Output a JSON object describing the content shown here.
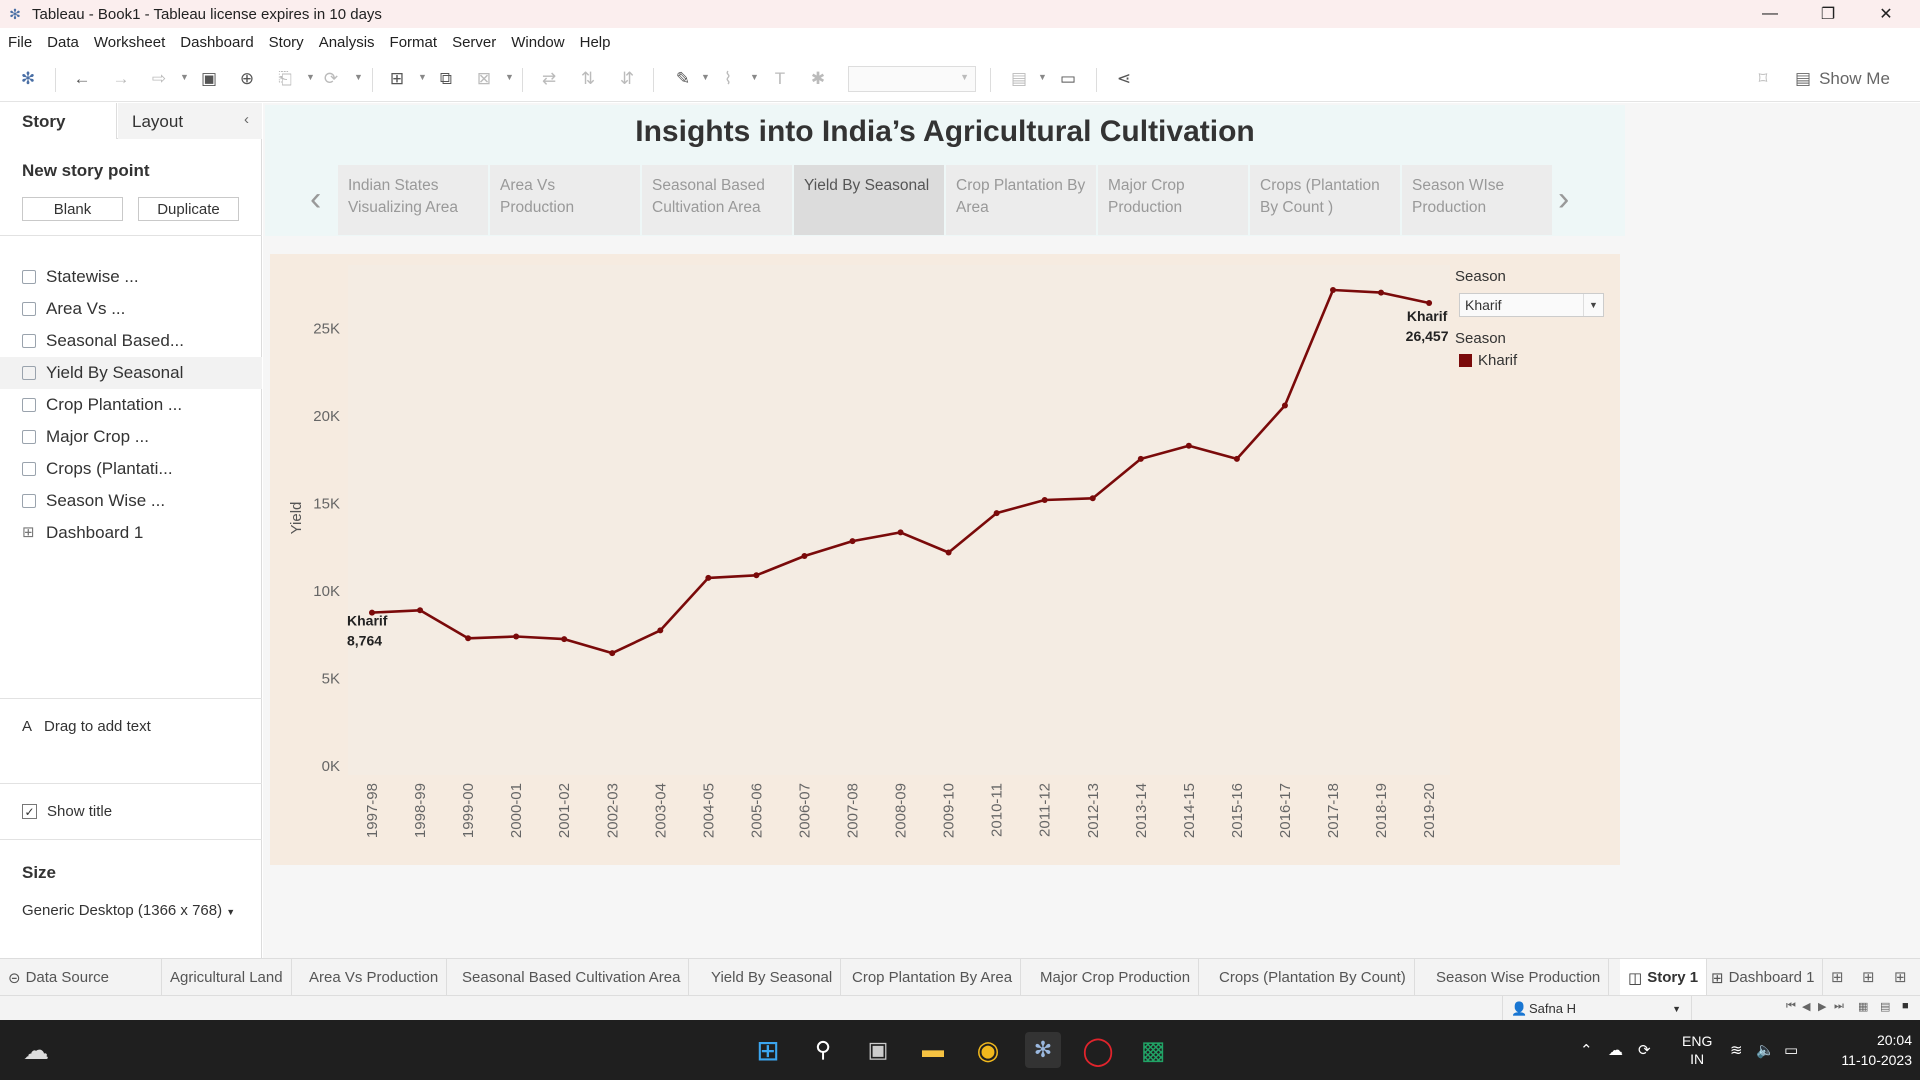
{
  "window": {
    "title": "Tableau - Book1 - Tableau license expires in 10 days",
    "minimize": "—",
    "restore": "❐",
    "close": "✕"
  },
  "menu": [
    "File",
    "Data",
    "Worksheet",
    "Dashboard",
    "Story",
    "Analysis",
    "Format",
    "Server",
    "Window",
    "Help"
  ],
  "toolbar": {
    "show_me": "Show Me"
  },
  "left_pane": {
    "tab_story": "Story",
    "tab_layout": "Layout",
    "new_story_point": "New story point",
    "blank": "Blank",
    "duplicate": "Duplicate",
    "story_points": [
      "Statewise ...",
      "Area Vs ...",
      "Seasonal Based...",
      "Yield By Seasonal",
      "Crop Plantation ...",
      "Major Crop ...",
      "Crops (Plantati...",
      "Season Wise ...",
      "Dashboard 1"
    ],
    "drag_text": "Drag to add text",
    "show_title": "Show title",
    "size_label": "Size",
    "size_value": "Generic Desktop (1366 x 768)"
  },
  "story": {
    "title": "Insights into India’s Agricultural Cultivation",
    "points": [
      {
        "label": "Indian States Visualizing Area"
      },
      {
        "label": "Area Vs Production"
      },
      {
        "label": "Seasonal Based Cultivation Area"
      },
      {
        "label": "Yield By Seasonal"
      },
      {
        "label": "Crop Plantation By Area"
      },
      {
        "label": "Major Crop Production"
      },
      {
        "label": "Crops (Plantation By Count )"
      },
      {
        "label": "Season WIse Production"
      }
    ],
    "active_index": 3
  },
  "legend": {
    "filter_title": "Season",
    "filter_value": "Kharif",
    "color_title": "Season",
    "items": [
      {
        "name": "Kharif",
        "color": "#7a0a0a"
      }
    ]
  },
  "chart_data": {
    "type": "line",
    "ylabel": "Yield",
    "ylim": [
      0,
      30000
    ],
    "yticks": [
      0,
      5000,
      10000,
      15000,
      20000,
      25000
    ],
    "ytick_labels": [
      "0K",
      "5K",
      "10K",
      "15K",
      "20K",
      "25K"
    ],
    "grid": false,
    "legend": "top-right",
    "x": [
      "1997-98",
      "1998-99",
      "1999-00",
      "2000-01",
      "2001-02",
      "2002-03",
      "2003-04",
      "2004-05",
      "2005-06",
      "2006-07",
      "2007-08",
      "2008-09",
      "2009-10",
      "2010-11",
      "2011-12",
      "2012-13",
      "2013-14",
      "2014-15",
      "2015-16",
      "2016-17",
      "2017-18",
      "2018-19",
      "2019-20"
    ],
    "series": [
      {
        "name": "Kharif",
        "color": "#7a0a0a",
        "values": [
          8764,
          8900,
          7300,
          7400,
          7250,
          6450,
          7750,
          10750,
          10900,
          12000,
          12850,
          13350,
          12200,
          14450,
          15200,
          15300,
          17550,
          18300,
          17550,
          20600,
          27200,
          27050,
          26457
        ]
      }
    ],
    "annotations": [
      {
        "series": "Kharif",
        "index": 0,
        "label": "Kharif",
        "value": "8,764"
      },
      {
        "series": "Kharif",
        "index": 22,
        "label": "Kharif",
        "value": "26,457"
      }
    ]
  },
  "sheet_tabs": {
    "data_source": "Data Source",
    "tabs": [
      "Agricultural Land",
      "Area Vs Production",
      "Seasonal Based Cultivation Area",
      "Yield By Seasonal",
      "Crop Plantation By Area",
      "Major Crop Production",
      "Crops (Plantation By Count)",
      "Season Wise Production"
    ],
    "story": "Story 1",
    "dashboard": "Dashboard 1"
  },
  "status": {
    "user": "Safna H"
  },
  "taskbar": {
    "lang": "ENG",
    "region": "IN",
    "time": "20:04",
    "date": "11-10-2023"
  }
}
